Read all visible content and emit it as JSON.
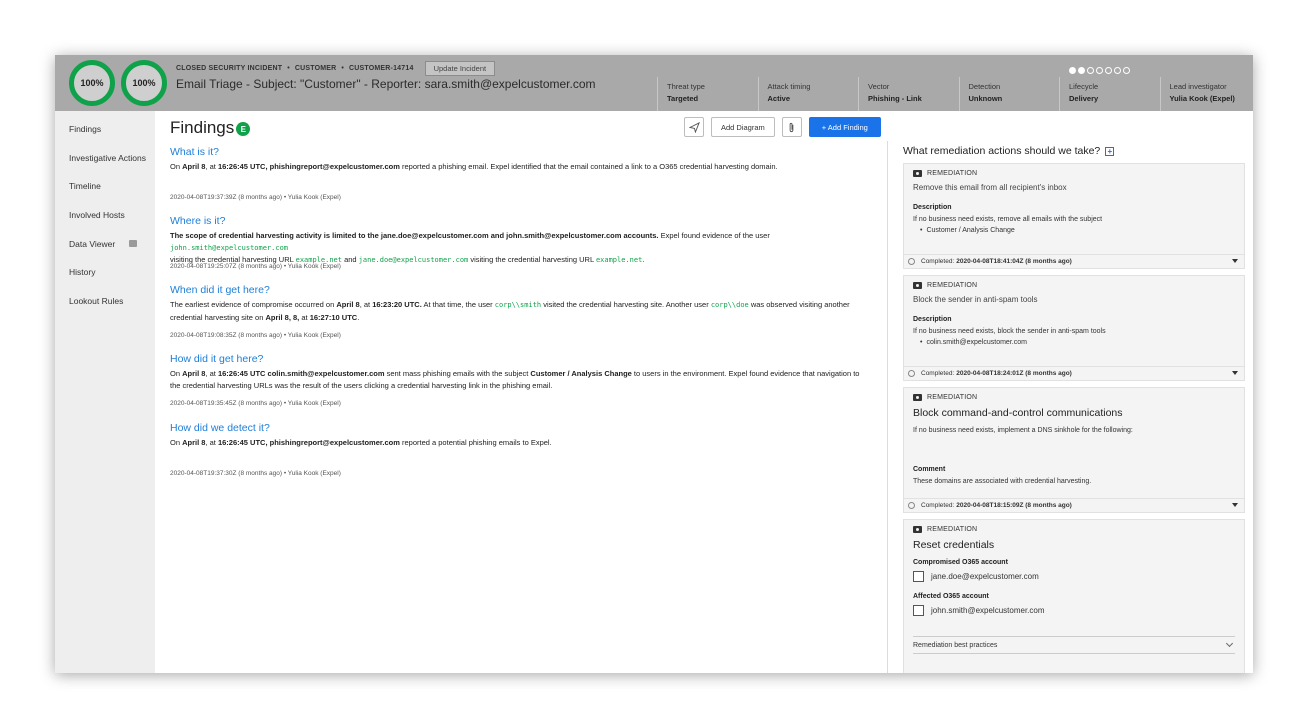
{
  "header": {
    "progress_1": "100%",
    "progress_2": "100%",
    "status": "CLOSED SECURITY INCIDENT",
    "customer_label": "CUSTOMER",
    "incident_id": "CUSTOMER-14714",
    "update_button": "Update Incident",
    "title": "Email Triage - Subject: \"Customer\" - Reporter: sara.smith@expelcustomer.com",
    "pager": {
      "total": 7,
      "active": 2
    },
    "stats": [
      {
        "label": "Threat type",
        "value": "Targeted"
      },
      {
        "label": "Attack timing",
        "value": "Active"
      },
      {
        "label": "Vector",
        "value": "Phishing - Link"
      },
      {
        "label": "Detection",
        "value": "Unknown"
      },
      {
        "label": "Lifecycle",
        "value": "Delivery"
      },
      {
        "label": "Lead investigator",
        "value": "Yulia Kook (Expel)"
      }
    ]
  },
  "sidebar": {
    "items": [
      {
        "label": "Findings"
      },
      {
        "label": "Investigative Actions"
      },
      {
        "label": "Timeline"
      },
      {
        "label": "Involved Hosts"
      },
      {
        "label": "Data Viewer"
      },
      {
        "label": "History"
      },
      {
        "label": "Lookout Rules"
      }
    ]
  },
  "main": {
    "title": "Findings",
    "badge": "E",
    "toolbar": {
      "add_diagram": "Add Diagram",
      "add_finding": "+ Add Finding"
    },
    "findings": [
      {
        "question": "What is it?",
        "answer_html_parts": [
          "On ",
          "April 8",
          ", at ",
          "16:26:45 UTC, phishingreport@expelcustomer.com",
          " reported a phishing email. Expel identified that the email contained a link to a O365 credential harvesting domain."
        ],
        "stamp": "2020-04-08T19:37:39Z (8 months ago) • Yulia Kook (Expel)"
      },
      {
        "question": "Where is it?",
        "a1_bold": "The scope of credential harvesting activity is limited to the jane.doe@expelcustomer.com and john.smith@expelcustomer.com accounts.",
        "a1_rest": " Expel found evidence of the user ",
        "a1_code1": "john.smith@expelcustomer.com",
        "a1_rest2": "visiting the credential harvesting URL ",
        "a1_code2": "example.net",
        "a1_and": " and ",
        "a1_code3": "jane.doe@expelcustomer.com",
        "a1_rest3": " visiting the credential harvesting URL ",
        "a1_code4": "example.net",
        "a1_end": ".",
        "stamp": "2020-04-08T19:25:07Z (8 months ago) • Yulia Kook (Expel)"
      },
      {
        "question": "When did it get here?",
        "p1": "The earliest evidence of compromise occurred on ",
        "b1": "April 8",
        "p2": ", at ",
        "b2": "16:23:20 UTC.",
        "p3": " At that time, the user ",
        "c1": "corp\\\\smith",
        "p4": " visited the credential harvesting site. Another user ",
        "c2": "corp\\\\doe",
        "p5": " was observed visiting another credential harvesting site on ",
        "b3": "April 8, 8,",
        "p6": " at ",
        "b4": "16:27:10 UTC",
        "p7": ".",
        "stamp": "2020-04-08T19:08:35Z (8 months ago) • Yulia Kook (Expel)"
      },
      {
        "question": "How did it get here?",
        "p1": "On ",
        "b1": "April 8",
        "p2": ", at ",
        "b2": "16:26:45 UTC colin.smith@expelcustomer.com",
        "p3": " sent mass phishing emails with the subject ",
        "b3": "Customer / Analysis Change",
        "p4": " to users in the environment. Expel found evidence that navigation to the credential harvesting URLs was the result of the users clicking a credential harvesting link in the phishing email.",
        "stamp": "2020-04-08T19:35:45Z (8 months ago) • Yulia Kook (Expel)"
      },
      {
        "question": "How did we detect it?",
        "p1": "On ",
        "b1": "April 8",
        "p2": ", at ",
        "b2": "16:26:45 UTC, phishingreport@expelcustomer.com",
        "p3": " reported a potential phishing emails to Expel.",
        "stamp": "2020-04-08T19:37:30Z (8 months ago) • Yulia Kook (Expel)"
      }
    ]
  },
  "remediation": {
    "title": "What remediation actions should we take?",
    "card_label": "REMEDIATION",
    "cards": [
      {
        "title": "Remove this email from all recipient's inbox",
        "desc_label": "Description",
        "desc": "If no business need exists, remove all emails with the subject",
        "bullet": "Customer / Analysis Change",
        "completed_label": "Completed:",
        "completed_value": "2020-04-08T18:41:04Z (8 months ago)"
      },
      {
        "title": "Block the sender in anti-spam tools",
        "desc_label": "Description",
        "desc": "If no business need exists, block the sender in anti-spam tools",
        "bullet": "colin.smith@expelcustomer.com",
        "completed_label": "Completed:",
        "completed_value": "2020-04-08T18:24:01Z (8 months ago)"
      },
      {
        "title": "Block command-and-control communications",
        "desc": "If no business need exists, implement a DNS sinkhole for the following:",
        "comment_label": "Comment",
        "comment": "These domains are associated with credential harvesting.",
        "completed_label": "Completed:",
        "completed_value": "2020-04-08T18:15:09Z (8 months ago)"
      },
      {
        "title": "Reset credentials",
        "field1_label": "Compromised O365 account",
        "field1_value": "jane.doe@expelcustomer.com",
        "field2_label": "Affected O365 account",
        "field2_value": "john.smith@expelcustomer.com",
        "best_practices": "Remediation best practices"
      }
    ]
  }
}
